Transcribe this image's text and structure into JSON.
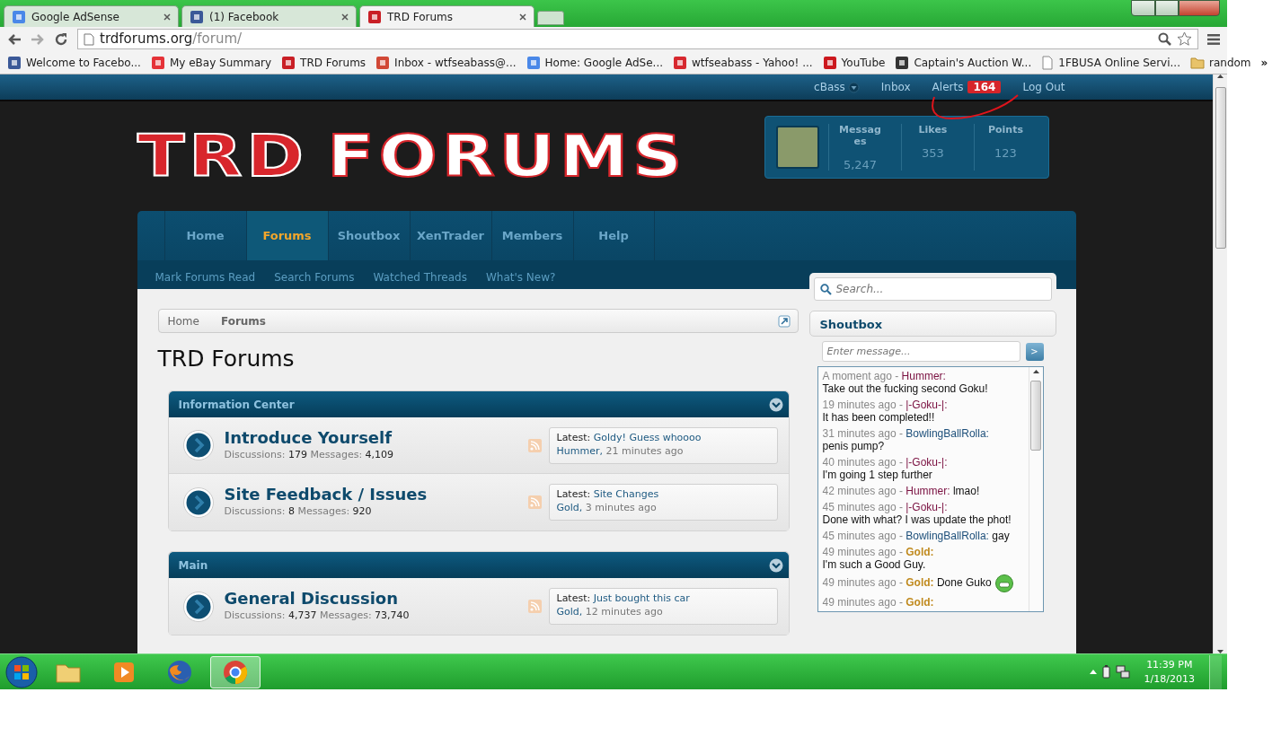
{
  "browser": {
    "tabs": [
      {
        "title": "Google AdSense",
        "selected": false,
        "kind": "g"
      },
      {
        "title": "(1) Facebook",
        "selected": false,
        "kind": "f"
      },
      {
        "title": "TRD Forums",
        "selected": true,
        "kind": "trd"
      }
    ],
    "address": {
      "host": "trdforums.org",
      "path": "/forum/"
    },
    "bookmarks": [
      {
        "label": "Welcome to Facebo...",
        "kind": "f"
      },
      {
        "label": "My eBay Summary",
        "kind": "ebay"
      },
      {
        "label": "TRD Forums",
        "kind": "trd"
      },
      {
        "label": "Inbox - wtfseabass@...",
        "kind": "gmail"
      },
      {
        "label": "Home: Google AdSe...",
        "kind": "g"
      },
      {
        "label": "wtfseabass - Yahoo! ...",
        "kind": "c"
      },
      {
        "label": "YouTube",
        "kind": "yt"
      },
      {
        "label": "Captain's Auction W...",
        "kind": "pirate"
      },
      {
        "label": "1FBUSA Online Servi...",
        "kind": "page"
      },
      {
        "label": "random",
        "kind": "folder"
      }
    ],
    "overflow": "»"
  },
  "forum": {
    "user_links": {
      "user": "cBass",
      "inbox": "Inbox",
      "alerts": "Alerts",
      "alerts_count": "164",
      "logout": "Log Out"
    },
    "logo": {
      "left": "TRD",
      "right": "FORUMS"
    },
    "stats": [
      {
        "label": "Messages",
        "value": "5,247"
      },
      {
        "label": "Likes",
        "value": "353"
      },
      {
        "label": "Points",
        "value": "123"
      }
    ],
    "nav": [
      {
        "label": "Home",
        "selected": false
      },
      {
        "label": "Forums",
        "selected": true
      },
      {
        "label": "Shoutbox",
        "selected": false
      },
      {
        "label": "XenTrader",
        "selected": false
      },
      {
        "label": "Members",
        "selected": false
      },
      {
        "label": "Help",
        "selected": false
      }
    ],
    "subnav": [
      "Mark Forums Read",
      "Search Forums",
      "Watched Threads",
      "What's New?"
    ],
    "search": {
      "placeholder": "Search..."
    },
    "breadcrumb": [
      {
        "label": "Home",
        "current": false
      },
      {
        "label": "Forums",
        "current": true
      }
    ],
    "title": "TRD Forums",
    "categories": [
      {
        "title": "Information Center",
        "forums": [
          {
            "title": "Introduce Yourself",
            "stats": [
              {
                "label": "Discussions:",
                "value": "179"
              },
              {
                "label": "Messages:",
                "value": "4,109"
              }
            ],
            "latest": {
              "label": "Latest:",
              "thread": "Goldy! Guess whoooo",
              "user": "Hummer,",
              "time": "21 minutes ago"
            }
          },
          {
            "title": "Site Feedback / Issues",
            "stats": [
              {
                "label": "Discussions:",
                "value": "8"
              },
              {
                "label": "Messages:",
                "value": "920"
              }
            ],
            "latest": {
              "label": "Latest:",
              "thread": "Site Changes",
              "user": "Gold,",
              "time": "3 minutes ago"
            }
          }
        ]
      },
      {
        "title": "Main",
        "forums": [
          {
            "title": "General Discussion",
            "stats": [
              {
                "label": "Discussions:",
                "value": "4,737"
              },
              {
                "label": "Messages:",
                "value": "73,740"
              }
            ],
            "latest": {
              "label": "Latest:",
              "thread": "Just bought this car",
              "user": "Gold,",
              "time": "12 minutes ago"
            }
          }
        ]
      }
    ],
    "shoutbox": {
      "title": "Shoutbox",
      "placeholder": "Enter message...",
      "send": ">",
      "messages": [
        {
          "time": "A moment ago -",
          "user": "Hummer:",
          "color": "#7a1040",
          "bold": false,
          "inline": false,
          "text": "Take out the fucking second Goku!",
          "smiley": false
        },
        {
          "time": "19 minutes ago -",
          "user": "|-Goku-|:",
          "color": "#7a1040",
          "bold": false,
          "inline": false,
          "text": "It has been completed!!",
          "smiley": false
        },
        {
          "time": "31 minutes ago -",
          "user": "BowlingBallRolla:",
          "color": "#1d4f7a",
          "bold": false,
          "inline": false,
          "text": "penis pump?",
          "smiley": false
        },
        {
          "time": "40 minutes ago -",
          "user": "|-Goku-|:",
          "color": "#7a1040",
          "bold": false,
          "inline": false,
          "text": "I'm going 1 step further",
          "smiley": false
        },
        {
          "time": "42 minutes ago -",
          "user": "Hummer:",
          "color": "#7a1040",
          "bold": false,
          "inline": true,
          "text": "lmao!",
          "smiley": false
        },
        {
          "time": "45 minutes ago -",
          "user": "|-Goku-|:",
          "color": "#7a1040",
          "bold": false,
          "inline": false,
          "text": "Done with what? I was update the phot!",
          "smiley": false
        },
        {
          "time": "45 minutes ago -",
          "user": "BowlingBallRolla:",
          "color": "#1d4f7a",
          "bold": false,
          "inline": true,
          "text": "gay",
          "smiley": false
        },
        {
          "time": "49 minutes ago -",
          "user": "Gold:",
          "color": "#c08a1e",
          "bold": true,
          "inline": false,
          "text": "I'm such a Good Guy.",
          "smiley": false
        },
        {
          "time": "49 minutes ago -",
          "user": "Gold:",
          "color": "#c08a1e",
          "bold": true,
          "inline": true,
          "text": "Done Guko",
          "smiley": true
        },
        {
          "time": "49 minutes ago -",
          "user": "Gold:",
          "color": "#c08a1e",
          "bold": true,
          "smiley": false
        }
      ]
    }
  },
  "taskbar": {
    "apps": [
      {
        "kind": "folder",
        "active": false
      },
      {
        "kind": "media",
        "active": false
      },
      {
        "kind": "firefox",
        "active": false
      },
      {
        "kind": "chrome",
        "active": true
      }
    ],
    "time": "11:39 PM",
    "date": "1/18/2013"
  }
}
